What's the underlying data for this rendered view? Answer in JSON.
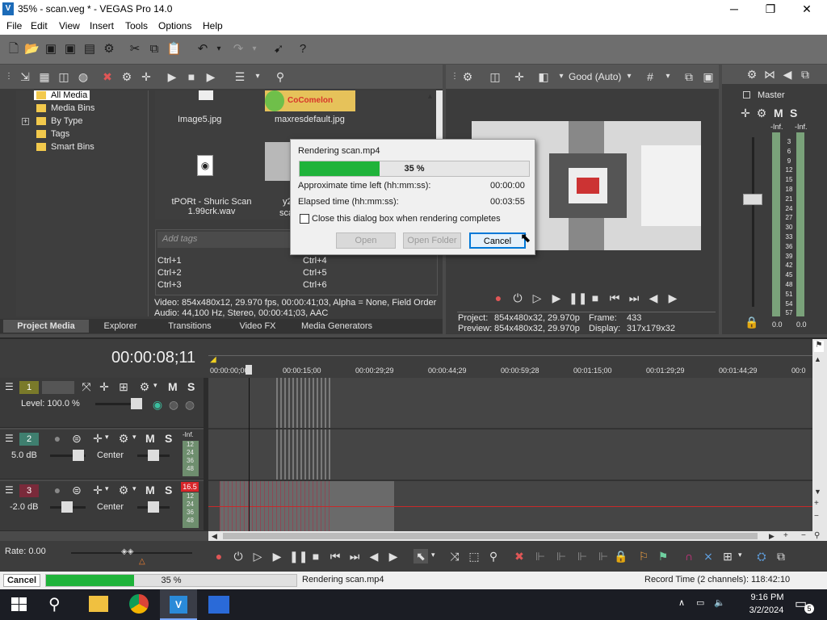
{
  "window": {
    "title": "35% - scan.veg * - VEGAS Pro 14.0",
    "min": "─",
    "max": "❐",
    "close": "✕"
  },
  "menu": [
    "File",
    "Edit",
    "View",
    "Insert",
    "Tools",
    "Options",
    "Help"
  ],
  "media_tree": {
    "items": [
      "All Media",
      "Media Bins",
      "By Type",
      "Tags",
      "Smart Bins"
    ],
    "expand": "+"
  },
  "media_files": [
    {
      "name": "Image5.jpg"
    },
    {
      "name": "maxresdefault.jpg",
      "thumb_text": "CoComelon"
    },
    {
      "name": "tPORt - Shuric Scan 1.99crk.wav"
    },
    {
      "name": "y2"
    },
    {
      "name": "sca"
    }
  ],
  "tags": {
    "placeholder": "Add tags",
    "shortcuts": [
      "Ctrl+1",
      "Ctrl+2",
      "Ctrl+3",
      "Ctrl+4",
      "Ctrl+5",
      "Ctrl+6"
    ]
  },
  "media_info": {
    "video": "Video: 854x480x12, 29.970 fps, 00:00:41;03, Alpha = None, Field Order",
    "audio": "Audio: 44,100 Hz, Stereo, 00:00:41;03, AAC"
  },
  "tabs": [
    "Project Media",
    "Explorer",
    "Transitions",
    "Video FX",
    "Media Generators"
  ],
  "preview": {
    "quality": "Good (Auto)",
    "project_label": "Project:",
    "project": "854x480x32, 29.970p",
    "frame_label": "Frame:",
    "frame": "433",
    "preview_label": "Preview:",
    "preview": "854x480x32, 29.970p",
    "display_label": "Display:",
    "display": "317x179x32"
  },
  "master": {
    "label": "Master",
    "inf_l": "-Inf.",
    "inf_r": "-Inf.",
    "scale": [
      "3",
      "6",
      "9",
      "12",
      "15",
      "18",
      "21",
      "24",
      "27",
      "30",
      "33",
      "36",
      "39",
      "42",
      "45",
      "48",
      "51",
      "54",
      "57"
    ],
    "val_l": "0.0",
    "val_r": "0.0"
  },
  "timeline": {
    "timecode": "00:00:08;11",
    "ruler": [
      "00:00:00;00",
      "00:00:15;00",
      "00:00:29;29",
      "00:00:44;29",
      "00:00:59;28",
      "00:01:15;00",
      "00:01:29;29",
      "00:01:44;29",
      "00:0"
    ]
  },
  "tracks": [
    {
      "num": "1",
      "level": "Level: 100.0 %",
      "m": "M",
      "s": "S"
    },
    {
      "num": "2",
      "vol": "5.0 dB",
      "pan": "Center",
      "m": "M",
      "s": "S",
      "inf": "-Inf.",
      "meter": [
        "12",
        "24",
        "36",
        "48"
      ]
    },
    {
      "num": "3",
      "vol": "-2.0 dB",
      "pan": "Center",
      "m": "M",
      "s": "S",
      "peak": "16.5",
      "meter": [
        "12",
        "24",
        "36",
        "48"
      ]
    }
  ],
  "rate": "Rate: 0.00",
  "render_dialog": {
    "title": "Rendering scan.mp4",
    "progress": 0.35,
    "percent": "35 %",
    "time_left_label": "Approximate time left (hh:mm:ss):",
    "time_left": "00:00:00",
    "elapsed_label": "Elapsed time (hh:mm:ss):",
    "elapsed": "00:03:55",
    "close_checkbox": "Close this dialog box when rendering completes",
    "open": "Open",
    "open_folder": "Open Folder",
    "cancel": "Cancel"
  },
  "status": {
    "cancel": "Cancel",
    "percent": "35 %",
    "progress": 0.35,
    "message": "Rendering scan.mp4",
    "record_time": "Record Time (2 channels): 118:42:10"
  },
  "taskbar": {
    "time": "9:16 PM",
    "date": "3/2/2024",
    "notif": "5"
  },
  "colors": {
    "progress": "#1fb33a",
    "track1": "#7a7a2a",
    "track2": "#3f7f6f",
    "track3": "#7a2a3a"
  }
}
